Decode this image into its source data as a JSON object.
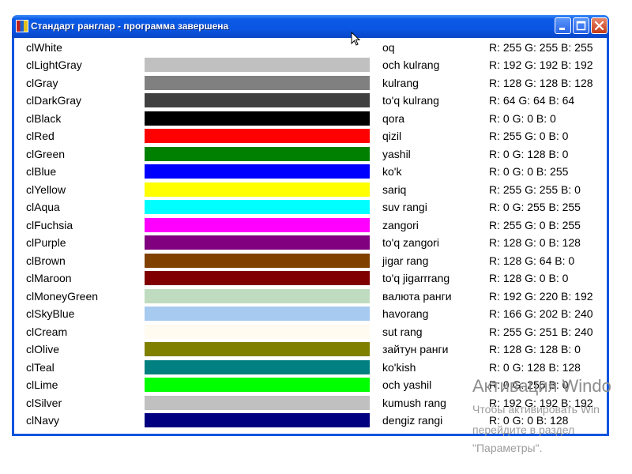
{
  "window": {
    "title": "Стандарт ранглар - программа завершена",
    "buttons": {
      "minimize": "minimize",
      "maximize": "maximize",
      "close": "close"
    }
  },
  "colors": [
    {
      "name": "clWhite",
      "uz": "oq",
      "rgb": "R: 255 G: 255 B: 255",
      "hex": "#FFFFFF"
    },
    {
      "name": "clLightGray",
      "uz": "och kulrang",
      "rgb": "R: 192 G: 192 B: 192",
      "hex": "#C0C0C0"
    },
    {
      "name": "clGray",
      "uz": "kulrang",
      "rgb": "R: 128 G: 128 B: 128",
      "hex": "#808080"
    },
    {
      "name": "clDarkGray",
      "uz": "to'q kulrang",
      "rgb": "R: 64 G: 64 B: 64",
      "hex": "#404040"
    },
    {
      "name": "clBlack",
      "uz": "qora",
      "rgb": "R: 0 G: 0 B: 0",
      "hex": "#000000"
    },
    {
      "name": "clRed",
      "uz": "qizil",
      "rgb": "R: 255 G: 0 B: 0",
      "hex": "#FF0000"
    },
    {
      "name": "clGreen",
      "uz": "yashil",
      "rgb": "R: 0 G: 128 B: 0",
      "hex": "#008000"
    },
    {
      "name": "clBlue",
      "uz": "ko'k",
      "rgb": "R: 0 G: 0 B: 255",
      "hex": "#0000FF"
    },
    {
      "name": "clYellow",
      "uz": "sariq",
      "rgb": "R: 255 G: 255 B: 0",
      "hex": "#FFFF00"
    },
    {
      "name": "clAqua",
      "uz": "suv rangi",
      "rgb": "R: 0 G: 255 B: 255",
      "hex": "#00FFFF"
    },
    {
      "name": "clFuchsia",
      "uz": "zangori",
      "rgb": "R: 255 G: 0 B: 255",
      "hex": "#FF00FF"
    },
    {
      "name": "clPurple",
      "uz": "to'q zangori",
      "rgb": "R: 128 G: 0 B: 128",
      "hex": "#800080"
    },
    {
      "name": "clBrown",
      "uz": "jigar rang",
      "rgb": "R: 128 G: 64 B: 0",
      "hex": "#804000"
    },
    {
      "name": "clMaroon",
      "uz": "to'q jigarrrang",
      "rgb": "R: 128 G: 0 B: 0",
      "hex": "#800000"
    },
    {
      "name": "clMoneyGreen",
      "uz": "валюта ранги",
      "rgb": "R: 192 G: 220 B: 192",
      "hex": "#C0DCC0"
    },
    {
      "name": "clSkyBlue",
      "uz": "havorang",
      "rgb": "R: 166 G: 202 B: 240",
      "hex": "#A6CAF0"
    },
    {
      "name": "clCream",
      "uz": "sut rang",
      "rgb": "R: 255 G: 251 B: 240",
      "hex": "#FFFBF0"
    },
    {
      "name": "clOlive",
      "uz": "зайтун ранги",
      "rgb": "R: 128 G: 128 B: 0",
      "hex": "#808000"
    },
    {
      "name": "clTeal",
      "uz": "ko'kish",
      "rgb": "R: 0 G: 128 B: 128",
      "hex": "#008080"
    },
    {
      "name": "clLime",
      "uz": "och yashil",
      "rgb": "R: 0 G: 255 B: 0",
      "hex": "#00FF00"
    },
    {
      "name": "clSilver",
      "uz": "kumush rang",
      "rgb": "R: 192 G: 192 B: 192",
      "hex": "#C0C0C0"
    },
    {
      "name": "clNavy",
      "uz": "dengiz rangi",
      "rgb": "R: 0 G: 0 B: 128",
      "hex": "#000080"
    }
  ],
  "watermark": {
    "line1": "Активация Windo",
    "line2": "Чтобы активировать Win",
    "line3": "перейдите в раздел",
    "line4": "\"Параметры\"."
  },
  "theme": {
    "titlebar_accent": "#0A56E2",
    "close_button": "#C43A16",
    "window_background": "#FFFFFF"
  }
}
